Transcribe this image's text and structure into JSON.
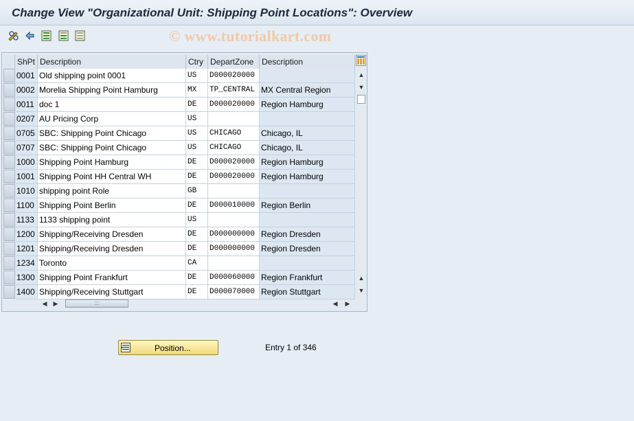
{
  "window": {
    "title": "Change View \"Organizational Unit: Shipping Point Locations\": Overview"
  },
  "watermark": "© www.tutorialkart.com",
  "toolbar": {
    "icons": [
      "edit-glasses-icon",
      "undo-change-icon",
      "select-all-icon",
      "select-block-icon",
      "deselect-all-icon"
    ]
  },
  "table": {
    "columns": [
      "ShPt",
      "Description",
      "Ctry",
      "DepartZone",
      "Description"
    ],
    "rows": [
      {
        "shpt": "0001",
        "desc": "Old shipping point 0001",
        "ctry": "US",
        "zone": "D000020000",
        "zdesc": ""
      },
      {
        "shpt": "0002",
        "desc": "Morelia Shipping Point Hamburg",
        "ctry": "MX",
        "zone": "TP_CENTRAL",
        "zdesc": "MX Central Region"
      },
      {
        "shpt": "0011",
        "desc": "doc 1",
        "ctry": "DE",
        "zone": "D000020000",
        "zdesc": "Region Hamburg"
      },
      {
        "shpt": "0207",
        "desc": "AU Pricing Corp",
        "ctry": "US",
        "zone": "",
        "zdesc": ""
      },
      {
        "shpt": "0705",
        "desc": "SBC: Shipping Point Chicago",
        "ctry": "US",
        "zone": "CHICAGO",
        "zdesc": "Chicago, IL"
      },
      {
        "shpt": "0707",
        "desc": "SBC: Shipping Point Chicago",
        "ctry": "US",
        "zone": "CHICAGO",
        "zdesc": "Chicago, IL"
      },
      {
        "shpt": "1000",
        "desc": "Shipping Point Hamburg",
        "ctry": "DE",
        "zone": "D000020000",
        "zdesc": "Region Hamburg"
      },
      {
        "shpt": "1001",
        "desc": "Shipping Point HH Central WH",
        "ctry": "DE",
        "zone": "D000020000",
        "zdesc": "Region Hamburg"
      },
      {
        "shpt": "1010",
        "desc": "shipping point Role",
        "ctry": "GB",
        "zone": "",
        "zdesc": ""
      },
      {
        "shpt": "1100",
        "desc": "Shipping Point Berlin",
        "ctry": "DE",
        "zone": "D000010000",
        "zdesc": "Region Berlin"
      },
      {
        "shpt": "1133",
        "desc": "1133 shipping point",
        "ctry": "US",
        "zone": "",
        "zdesc": ""
      },
      {
        "shpt": "1200",
        "desc": "Shipping/Receiving Dresden",
        "ctry": "DE",
        "zone": "D000000000",
        "zdesc": "Region Dresden"
      },
      {
        "shpt": "1201",
        "desc": "Shipping/Receiving Dresden",
        "ctry": "DE",
        "zone": "D000000000",
        "zdesc": "Region Dresden"
      },
      {
        "shpt": "1234",
        "desc": "Toronto",
        "ctry": "CA",
        "zone": "",
        "zdesc": ""
      },
      {
        "shpt": "1300",
        "desc": "Shipping Point Frankfurt",
        "ctry": "DE",
        "zone": "D000060000",
        "zdesc": "Region Frankfurt"
      },
      {
        "shpt": "1400",
        "desc": "Shipping/Receiving Stuttgart",
        "ctry": "DE",
        "zone": "D000070000",
        "zdesc": "Region Stuttgart"
      }
    ]
  },
  "footer": {
    "position_button": "Position...",
    "entry_info": "Entry 1 of 346"
  },
  "colors": {
    "background": "#e6edf4",
    "readonly_cell": "#dce7f1",
    "editable_cell": "#ffffff",
    "button_yellow": "#f3d97c"
  }
}
